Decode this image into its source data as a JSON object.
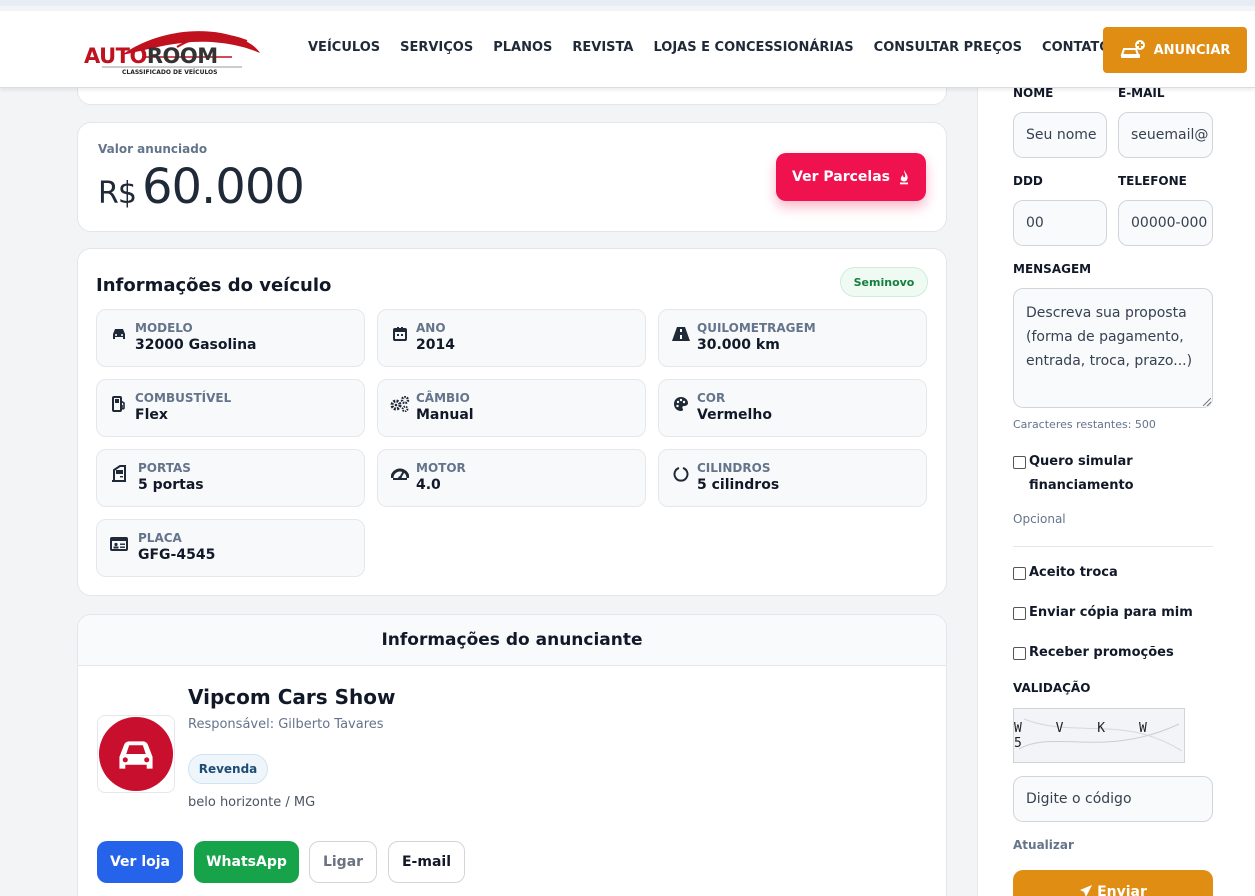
{
  "header": {
    "logo_brand_part1": "AUTO",
    "logo_brand_part2": "ROOM",
    "logo_tagline": "CLASSIFICADO DE VEÍCULOS",
    "nav": [
      "VEÍCULOS",
      "SERVIÇOS",
      "PLANOS",
      "REVISTA",
      "LOJAS E CONCESSIONÁRIAS",
      "CONSULTAR PREÇOS",
      "CONTATO"
    ],
    "cta_label": "ANUNCIAR",
    "cta_icon": "car-plus-icon",
    "cta_color": "#e08d13"
  },
  "price": {
    "label": "Valor anunciado",
    "currency": "R$",
    "value": "60.000",
    "button_label": "Ver Parcelas",
    "button_icon": "flame-icon",
    "button_color": "#f0124f"
  },
  "vehicle": {
    "title": "Informações do veículo",
    "badge": "Seminovo",
    "specs": [
      {
        "label": "MODELO",
        "value": "32000 Gasolina",
        "icon": "car-icon"
      },
      {
        "label": "ANO",
        "value": "2014",
        "icon": "calendar-icon"
      },
      {
        "label": "QUILOMETRAGEM",
        "value": "30.000 km",
        "icon": "road-icon"
      },
      {
        "label": "COMBUSTÍVEL",
        "value": "Flex",
        "icon": "fuel-pump-icon"
      },
      {
        "label": "CÂMBIO",
        "value": "Manual",
        "icon": "gears-icon"
      },
      {
        "label": "COR",
        "value": "Vermelho",
        "icon": "palette-icon"
      },
      {
        "label": "PORTAS",
        "value": "5 portas",
        "icon": "door-icon"
      },
      {
        "label": "MOTOR",
        "value": "4.0",
        "icon": "gauge-icon"
      },
      {
        "label": "CILINDROS",
        "value": "5 cilindros",
        "icon": "circle-notch-icon"
      },
      {
        "label": "PLACA",
        "value": "GFG-4545",
        "icon": "id-card-icon"
      }
    ]
  },
  "advertiser": {
    "title": "Informações do anunciante",
    "name": "Vipcom Cars Show",
    "responsible": "Responsável: Gilberto Tavares",
    "type_badge": "Revenda",
    "location": "belo horizonte / MG",
    "avatar_icon": "car-icon",
    "buttons": {
      "store": "Ver loja",
      "whatsapp": "WhatsApp",
      "call": "Ligar",
      "email": "E-mail"
    }
  },
  "form": {
    "name_label": "NOME",
    "name_placeholder": "Seu nome",
    "email_label": "E-MAIL",
    "email_placeholder": "seuemail@",
    "ddd_label": "DDD",
    "ddd_placeholder": "00",
    "phone_label": "TELEFONE",
    "phone_placeholder": "00000-000",
    "message_label": "MENSAGEM",
    "message_placeholder": "Descreva sua proposta (forma de pagamento, entrada, troca, prazo...)",
    "chars_remaining": "Caracteres restantes: 500",
    "simulate_label": "Quero simular financiamento",
    "optional_label": "Opcional",
    "trade_label": "Aceito troca",
    "copy_label": "Enviar cópia para mim",
    "promo_label": "Receber promoções",
    "validation_label": "VALIDAÇÃO",
    "captcha_text": "W V K W 5",
    "code_placeholder": "Digite o código",
    "refresh_label": "Atualizar",
    "submit_label": "Enviar",
    "submit_icon": "paper-plane-icon"
  }
}
